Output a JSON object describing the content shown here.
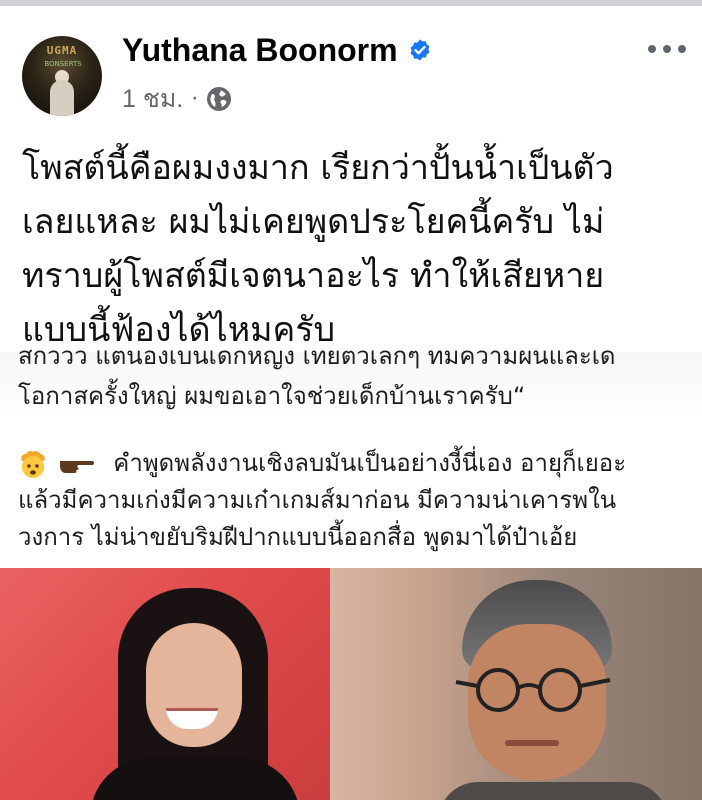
{
  "post": {
    "author_name": "Yuthana Boonorm",
    "time": "1 ชม.",
    "separator": "·",
    "avatar_text": "UGMA",
    "avatar_subtext": "BONSERTS",
    "text_lines": [
      "โพสต์นี้คือผมงงมาก เรียกว่าปั้นน้ำเป็นตัว",
      "เลยแหละ ผมไม่เคยพูดประโยคนี้ครับ ไม่",
      "ทราบผู้โพสต์มีเจตนาอะไร ทำให้เสียหาย",
      "แบบนี้ฟ้องได้ไหมครับ"
    ]
  },
  "shared": {
    "quote_line_1": "สกววว แตนองเบนเดกหญง เทยตวเลกๆ ทมความผนและเด",
    "quote_line_2": "โอกาสครั้งใหญ่ ผมขอเอาใจช่วยเด็กบ้านเราครับ“",
    "comment_lines": [
      "คำพูดพลังงานเชิงลบมันเป็นอย่างงี้นี่เอง   อายุก็เยอะ",
      "แล้วมีความเก่งมีความเก๋าเกมส์มาก่อน มีความน่าเคารพใน",
      "วงการ  ไม่น่าขยับริมฝีปากแบบนี้ออกสื่อ  พูดมาได้ป๋าเอ้ย"
    ]
  },
  "icons": {
    "verified": "verified-badge-icon",
    "globe": "globe-icon",
    "more": "more-options-icon",
    "emoji": "exploding-head-emoji-icon",
    "point": "pointing-hand-emoji-icon"
  },
  "colors": {
    "verified_blue": "#1877f2",
    "meta_gray": "#65676b",
    "photo_red": "#e04a4b"
  }
}
